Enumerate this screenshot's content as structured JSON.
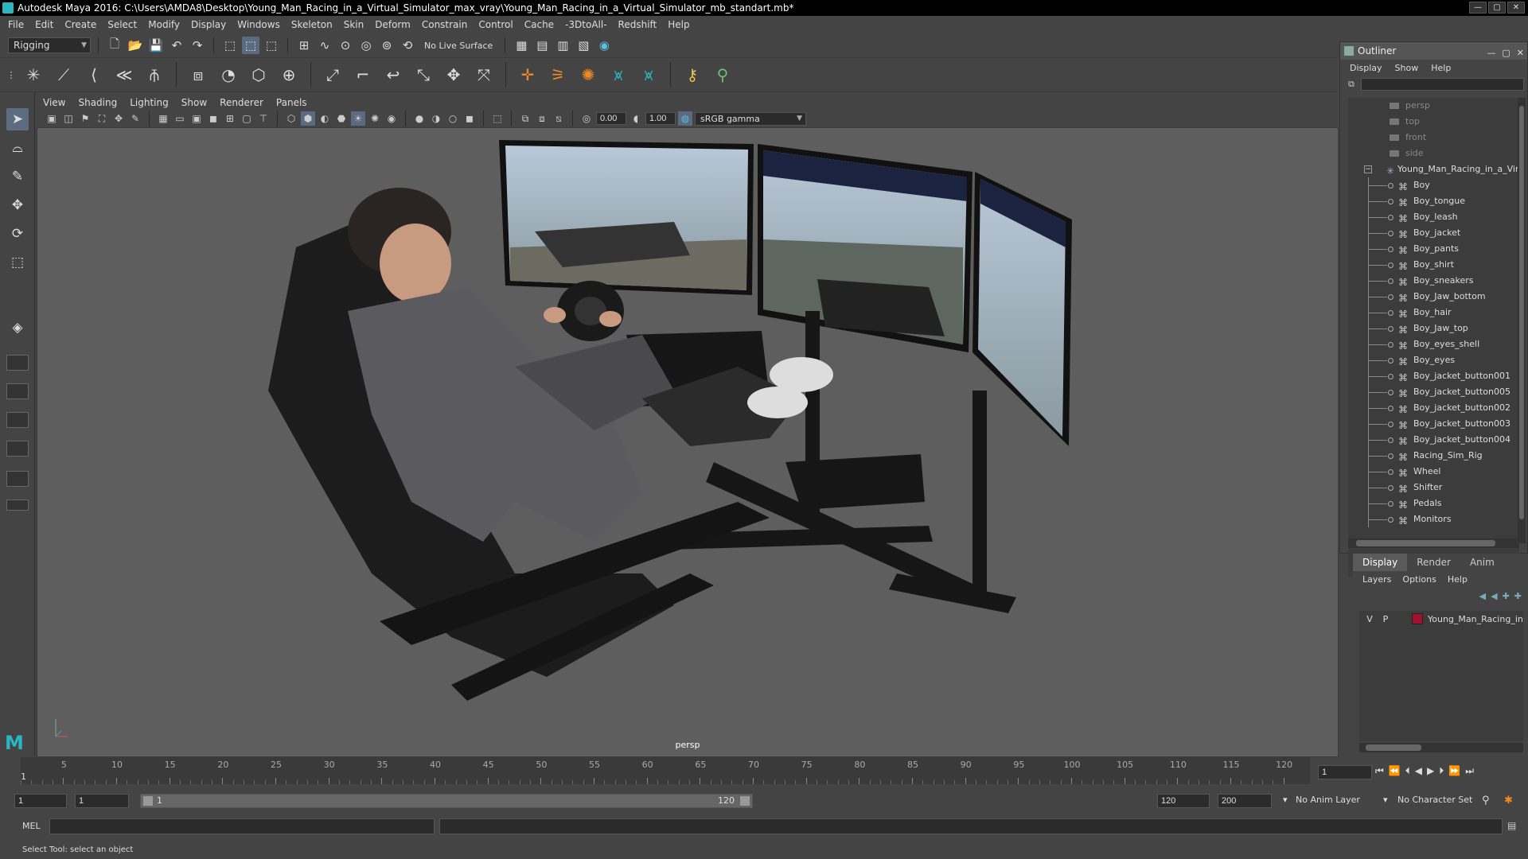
{
  "window": {
    "title": "Autodesk Maya 2016: C:\\Users\\AMDA8\\Desktop\\Young_Man_Racing_in_a_Virtual_Simulator_max_vray\\Young_Man_Racing_in_a_Virtual_Simulator_mb_standart.mb*"
  },
  "menu": [
    "File",
    "Edit",
    "Create",
    "Select",
    "Modify",
    "Display",
    "Windows",
    "Skeleton",
    "Skin",
    "Deform",
    "Constrain",
    "Control",
    "Cache",
    "-3DtoAll-",
    "Redshift",
    "Help"
  ],
  "toolbar": {
    "mode": "Rigging",
    "live_surface": "No Live Surface"
  },
  "viewport": {
    "menu": [
      "View",
      "Shading",
      "Lighting",
      "Show",
      "Renderer",
      "Panels"
    ],
    "field_a": "0.00",
    "field_b": "1.00",
    "color_space": "sRGB gamma",
    "camera": "persp"
  },
  "outliner": {
    "title": "Outliner",
    "menu": [
      "Display",
      "Show",
      "Help"
    ],
    "cameras": [
      "persp",
      "top",
      "front",
      "side"
    ],
    "root": "Young_Man_Racing_in_a_Virt",
    "children": [
      "Boy",
      "Boy_tongue",
      "Boy_leash",
      "Boy_jacket",
      "Boy_pants",
      "Boy_shirt",
      "Boy_sneakers",
      "Boy_Jaw_bottom",
      "Boy_hair",
      "Boy_Jaw_top",
      "Boy_eyes_shell",
      "Boy_eyes",
      "Boy_jacket_button001",
      "Boy_jacket_button005",
      "Boy_jacket_button002",
      "Boy_jacket_button003",
      "Boy_jacket_button004",
      "Racing_Sim_Rig",
      "Wheel",
      "Shifter",
      "Pedals",
      "Monitors"
    ]
  },
  "layers": {
    "tabs": [
      "Display",
      "Render",
      "Anim"
    ],
    "menu": [
      "Layers",
      "Options",
      "Help"
    ],
    "layer": {
      "v": "V",
      "p": "P",
      "name": "Young_Man_Racing_in"
    }
  },
  "timeline": {
    "labels": [
      "5",
      "10",
      "15",
      "20",
      "25",
      "30",
      "35",
      "40",
      "45",
      "50",
      "55",
      "60",
      "65",
      "70",
      "75",
      "80",
      "85",
      "90",
      "95",
      "100",
      "105",
      "110",
      "115",
      "120"
    ],
    "current": "1",
    "playhead": "1"
  },
  "range": {
    "start": "1",
    "inner_start": "1",
    "slider_start": "1",
    "slider_end": "120",
    "end": "120",
    "max": "200",
    "anim_layer": "No Anim Layer",
    "char_set": "No Character Set"
  },
  "command": {
    "label": "MEL"
  },
  "status": "Select Tool: select an object"
}
